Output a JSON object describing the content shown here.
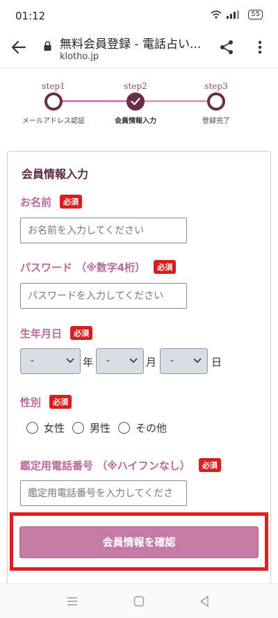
{
  "status_bar": {
    "time": "01:12",
    "battery": "55"
  },
  "browser": {
    "title": "無料会員登録 - 電話占い...",
    "url": "klotho.jp"
  },
  "stepper": {
    "steps": [
      {
        "num": "step1",
        "label": "メールアドレス認証"
      },
      {
        "num": "step2",
        "label": "会員情報入力"
      },
      {
        "num": "step3",
        "label": "登録完了"
      }
    ],
    "current_step": 2
  },
  "form": {
    "title": "会員情報入力",
    "required_badge": "必須",
    "name": {
      "label": "お名前",
      "placeholder": "お名前を入力してください"
    },
    "password": {
      "label": "パスワード （※数字4桁）",
      "placeholder": "パスワードを入力してください"
    },
    "birthday": {
      "label": "生年月日",
      "year_value": "-",
      "year_unit": "年",
      "month_value": "-",
      "month_unit": "月",
      "day_value": "-",
      "day_unit": "日"
    },
    "gender": {
      "label": "性別",
      "options": [
        "女性",
        "男性",
        "その他"
      ]
    },
    "phone": {
      "label": "鑑定用電話番号 （※ハイフンなし）",
      "placeholder": "鑑定用電話番号を入力してくださ"
    },
    "submit_label": "会員情報を確認"
  },
  "colors": {
    "accent": "#6b2e4a",
    "label": "#b8689a",
    "required": "#d81e1e",
    "button": "#c67ba6",
    "highlight": "#e02020"
  }
}
